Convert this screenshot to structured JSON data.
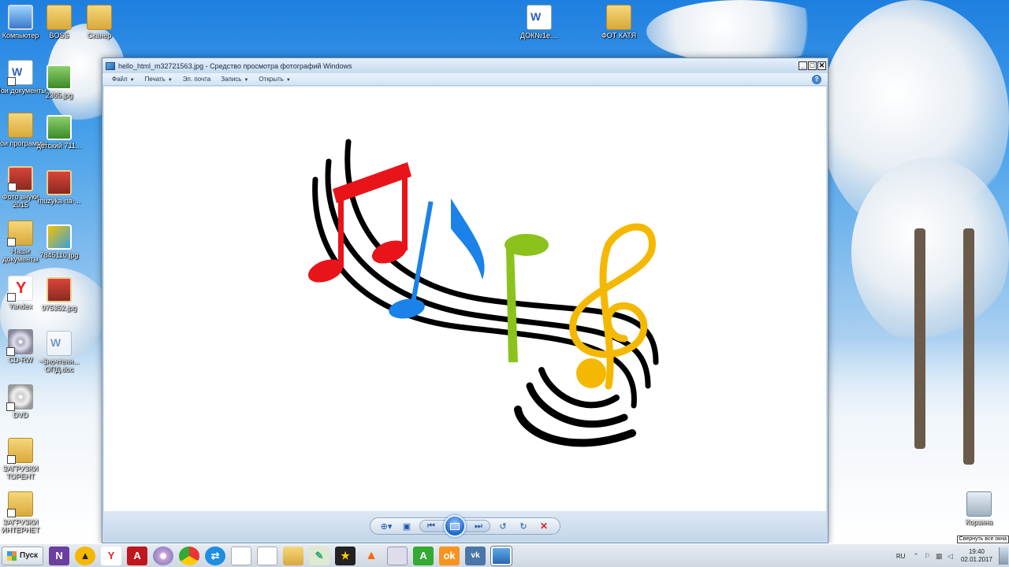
{
  "desktop": {
    "icons": [
      {
        "label": "Компьютер"
      },
      {
        "label": "BOSS"
      },
      {
        "label": "Сканер"
      },
      {
        "label": "ДОК№1е...."
      },
      {
        "label": "ФОТ КАТЯ"
      },
      {
        "label": "Мои документы"
      },
      {
        "label": "2365.jpg"
      },
      {
        "label": "Мои программы"
      },
      {
        "label": "детский 711..."
      },
      {
        "label": "Фото внуки 2015"
      },
      {
        "label": "muzyka-na-..."
      },
      {
        "label": "Наши документы"
      },
      {
        "label": "7845110.jpg"
      },
      {
        "label": "Yandex"
      },
      {
        "label": "975352.jpg"
      },
      {
        "label": "CD-RW"
      },
      {
        "label": "~$ночтенн... ОПД.doc"
      },
      {
        "label": "DVD"
      },
      {
        "label": "ЗАГРУЗКИ ТОРЕНТ"
      },
      {
        "label": "ЗАГРУЗКИ ИНТЕРНЕТ"
      },
      {
        "label": "Корзина"
      }
    ]
  },
  "window": {
    "title": "hello_html_m32721563.jpg - Средство просмотра фотографий Windows",
    "controls": {
      "minimize": "_",
      "maximize": "□",
      "close": "✕"
    },
    "menu": [
      {
        "label": "Файл"
      },
      {
        "label": "Печать"
      },
      {
        "label": "Эл. почта"
      },
      {
        "label": "Запись"
      },
      {
        "label": "Открыть"
      }
    ],
    "help": "?",
    "toolbar": {
      "zoom_icon": "magnifier-icon",
      "fit_icon": "actual-size-icon",
      "prev_icon": "previous-icon",
      "slideshow_icon": "slideshow-icon",
      "next_icon": "next-icon",
      "rotate_ccw_icon": "rotate-ccw-icon",
      "rotate_cw_icon": "rotate-cw-icon",
      "delete_icon": "delete-icon"
    }
  },
  "taskbar": {
    "start_label": "Пуск",
    "language": "RU",
    "time": "19:40",
    "date": "02.01.2017",
    "tooltip": "Свернуть все окна"
  },
  "colors": {
    "note_red": "#e8141a",
    "note_blue": "#1a82e8",
    "note_green": "#8cc21c",
    "clef_yellow": "#f5b800",
    "staff_black": "#000000"
  }
}
